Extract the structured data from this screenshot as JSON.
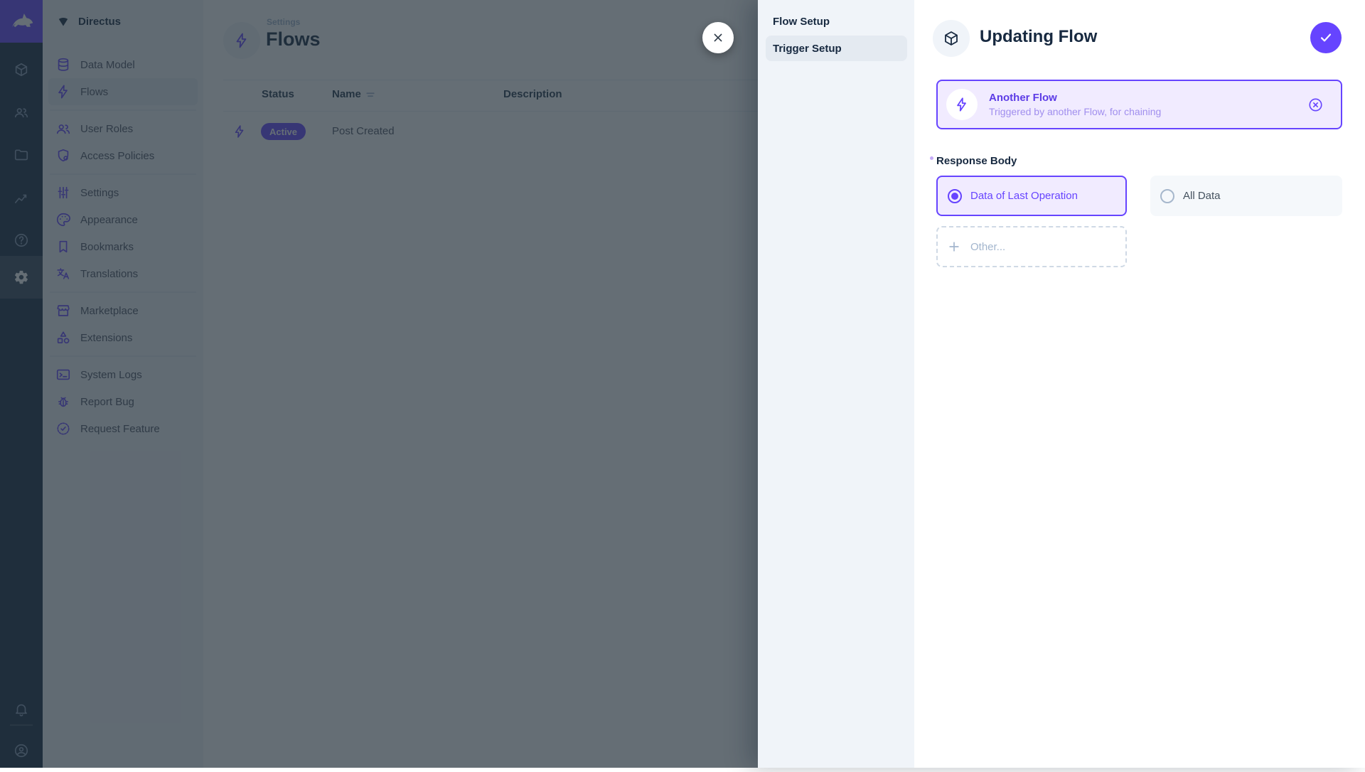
{
  "colors": {
    "accent": "#6644ff",
    "module_bar_bg": "#172940",
    "nav_bg": "#f0f4f9",
    "selected_bg": "#e4eaf1",
    "text_dark": "#172940",
    "text_muted": "#4f5464",
    "text_subdued": "#a2b5cd",
    "card_purple_bg": "#f1ebff",
    "overlay": "rgba(36,48,58,0.7)"
  },
  "module_bar": {
    "logo_icon": "directus-rabbit-icon",
    "modules": [
      {
        "icon": "content-box-icon",
        "active": false
      },
      {
        "icon": "users-icon",
        "active": false
      },
      {
        "icon": "files-folder-icon",
        "active": false
      },
      {
        "icon": "insights-chart-icon",
        "active": false
      },
      {
        "icon": "docs-help-icon",
        "active": false
      },
      {
        "icon": "settings-gear-icon",
        "active": true
      }
    ],
    "bottom": [
      {
        "icon": "notifications-bell-icon"
      },
      {
        "icon": "account-circle-icon"
      }
    ]
  },
  "nav": {
    "project_name": "Directus",
    "items": [
      {
        "label": "Data Model",
        "icon": "database-icon",
        "active": false
      },
      {
        "label": "Flows",
        "icon": "bolt-icon",
        "active": true
      },
      {
        "label": "User Roles",
        "icon": "people-icon",
        "active": false
      },
      {
        "label": "Access Policies",
        "icon": "shield-icon",
        "active": false
      },
      {
        "label": "Settings",
        "icon": "tune-icon",
        "active": false
      },
      {
        "label": "Appearance",
        "icon": "palette-icon",
        "active": false
      },
      {
        "label": "Bookmarks",
        "icon": "bookmark-icon",
        "active": false
      },
      {
        "label": "Translations",
        "icon": "translate-icon",
        "active": false
      },
      {
        "label": "Marketplace",
        "icon": "storefront-icon",
        "active": false
      },
      {
        "label": "Extensions",
        "icon": "category-icon",
        "active": false
      },
      {
        "label": "System Logs",
        "icon": "terminal-icon",
        "active": false
      },
      {
        "label": "Report Bug",
        "icon": "bug-icon",
        "active": false
      },
      {
        "label": "Request Feature",
        "icon": "feature-seal-icon",
        "active": false
      }
    ]
  },
  "main": {
    "breadcrumb": "Settings",
    "title": "Flows",
    "table": {
      "columns": [
        "Status",
        "Name",
        "Description"
      ],
      "rows": [
        {
          "status": "Active",
          "name": "Post Created",
          "description": ""
        }
      ]
    }
  },
  "drawer": {
    "sidebar": {
      "items": [
        {
          "label": "Flow Setup",
          "active": false
        },
        {
          "label": "Trigger Setup",
          "active": true
        }
      ]
    },
    "title": "Updating Flow",
    "trigger_card": {
      "title": "Another Flow",
      "subtitle": "Triggered by another Flow, for chaining"
    },
    "response_body": {
      "label": "Response Body",
      "required": true,
      "options": [
        {
          "label": "Data of Last Operation",
          "selected": true
        },
        {
          "label": "All Data",
          "selected": false
        }
      ],
      "other_placeholder": "Other..."
    }
  }
}
